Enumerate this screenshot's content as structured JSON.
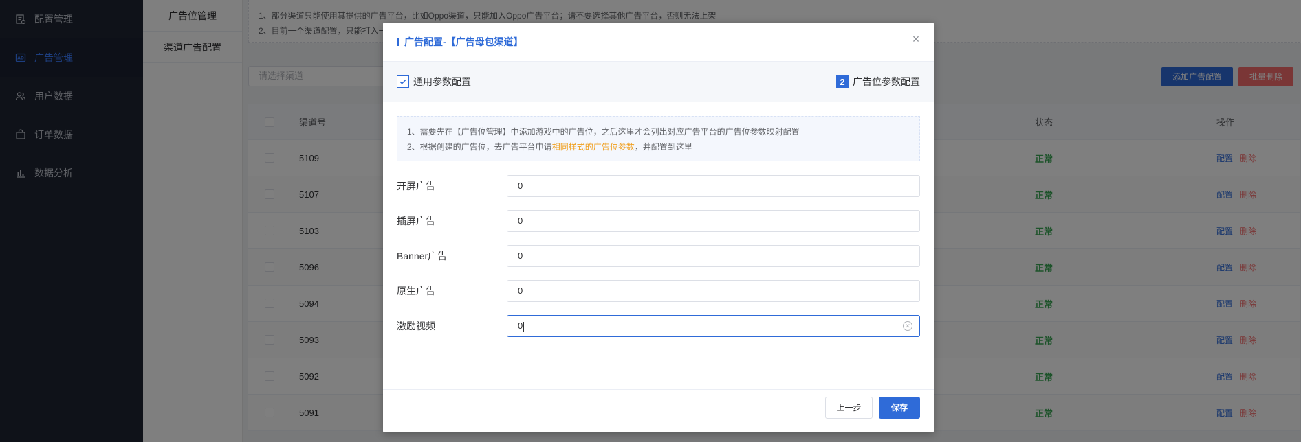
{
  "sidebar": {
    "items": [
      {
        "label": "配置管理",
        "icon": "config-icon"
      },
      {
        "label": "广告管理",
        "icon": "ad-icon"
      },
      {
        "label": "用户数据",
        "icon": "users-icon"
      },
      {
        "label": "订单数据",
        "icon": "order-icon"
      },
      {
        "label": "数据分析",
        "icon": "chart-icon"
      }
    ]
  },
  "submenu": {
    "items": [
      "广告位管理",
      "渠道广告配置"
    ]
  },
  "main": {
    "notice": {
      "line1": "1、部分渠道只能使用其提供的广告平台，比如Oppo渠道，只能加入Oppo广告平台；请不要选择其他广告平台，否则无法上架",
      "line2": "2、目前一个渠道配置，只能打入一"
    },
    "channel_select_placeholder": "请选择渠道",
    "add_button": "添加广告配置",
    "batch_delete_button": "批量删除",
    "table": {
      "headers": {
        "channel_id": "渠道号",
        "status": "状态",
        "action": "操作"
      },
      "rows": [
        {
          "id": "5109",
          "status": "正常"
        },
        {
          "id": "5107",
          "status": "正常"
        },
        {
          "id": "5103",
          "status": "正常"
        },
        {
          "id": "5096",
          "status": "正常"
        },
        {
          "id": "5094",
          "status": "正常"
        },
        {
          "id": "5093",
          "status": "正常"
        },
        {
          "id": "5092",
          "status": "正常"
        },
        {
          "id": "5091",
          "status": "正常"
        }
      ],
      "action_config": "配置",
      "action_delete": "删除"
    }
  },
  "dialog": {
    "title": "广告配置-【广告母包渠道】",
    "close_icon": "×",
    "steps": {
      "step1_label": "通用参数配置",
      "step2_number": "2",
      "step2_label": "广告位参数配置"
    },
    "tip": {
      "line1": "1、需要先在【广告位管理】中添加游戏中的广告位，之后这里才会列出对应广告平台的广告位参数映射配置",
      "line2_prefix": "2、根据创建的广告位，去广告平台申请",
      "line2_highlight": "相同样式的广告位参数",
      "line2_suffix": "，并配置到这里"
    },
    "fields": [
      {
        "label": "开屏广告",
        "value": "0"
      },
      {
        "label": "插屏广告",
        "value": "0"
      },
      {
        "label": "Banner广告",
        "value": "0"
      },
      {
        "label": "原生广告",
        "value": "0"
      },
      {
        "label": "激励视频",
        "value": "0"
      }
    ],
    "prev_button": "上一步",
    "save_button": "保存"
  },
  "colors": {
    "primary": "#2f6bd8",
    "danger": "#f56c6c",
    "success": "#3aa655",
    "highlight": "#f0a020",
    "sidebar_bg": "#1f2533"
  }
}
